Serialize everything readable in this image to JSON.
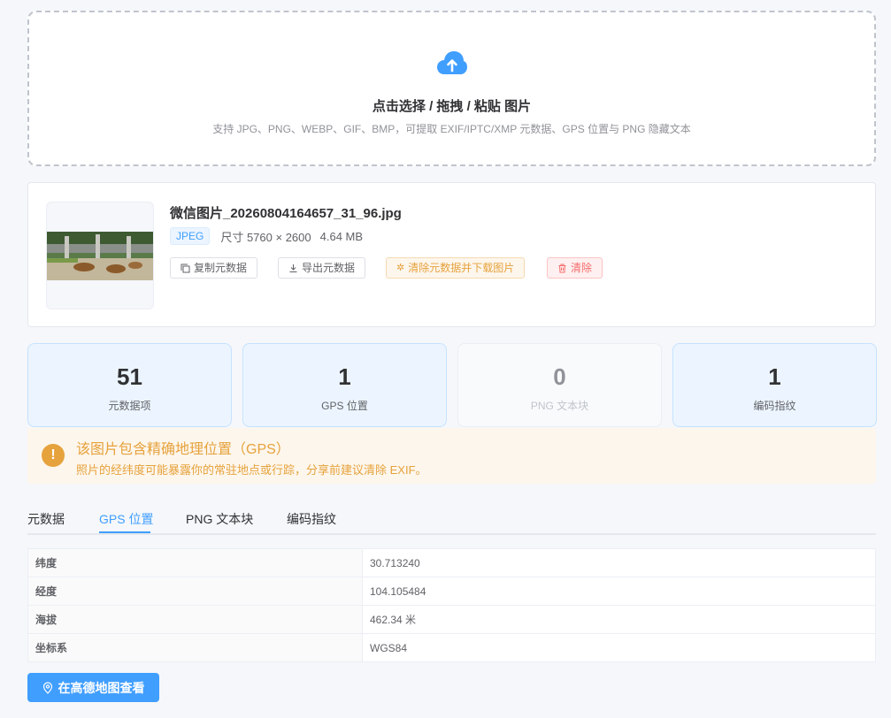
{
  "upload": {
    "title": "点击选择 / 拖拽 / 粘贴 图片",
    "hint": "支持 JPG、PNG、WEBP、GIF、BMP，可提取 EXIF/IPTC/XMP 元数据、GPS 位置与 PNG 隐藏文本",
    "icon": "cloud-upload-icon"
  },
  "file": {
    "name": "微信图片_20260804164657_31_96.jpg",
    "format": "JPEG",
    "dimensions": "尺寸 5760 × 2600",
    "size": "4.64 MB",
    "actions": {
      "copy": "复制元数据",
      "export": "导出元数据",
      "strip": "清除元数据并下载图片",
      "clear": "清除"
    }
  },
  "stats": [
    {
      "value": "51",
      "label": "元数据项"
    },
    {
      "value": "1",
      "label": "GPS 位置"
    },
    {
      "value": "0",
      "label": "PNG 文本块"
    },
    {
      "value": "1",
      "label": "编码指纹"
    }
  ],
  "alert": {
    "title": "该图片包含精确地理位置（GPS）",
    "description": "照片的经纬度可能暴露你的常驻地点或行踪，分享前建议清除 EXIF。"
  },
  "tabs": [
    {
      "label": "元数据"
    },
    {
      "label": "GPS 位置"
    },
    {
      "label": "PNG 文本块"
    },
    {
      "label": "编码指纹"
    }
  ],
  "gps": {
    "rows": [
      {
        "key": "纬度",
        "value": "30.713240"
      },
      {
        "key": "经度",
        "value": "104.105484"
      },
      {
        "key": "海拔",
        "value": "462.34 米"
      },
      {
        "key": "坐标系",
        "value": "WGS84"
      }
    ],
    "map_button": "在高德地图查看"
  },
  "colors": {
    "primary": "#409eff",
    "warning": "#e6a23c",
    "danger": "#f56c6c"
  }
}
